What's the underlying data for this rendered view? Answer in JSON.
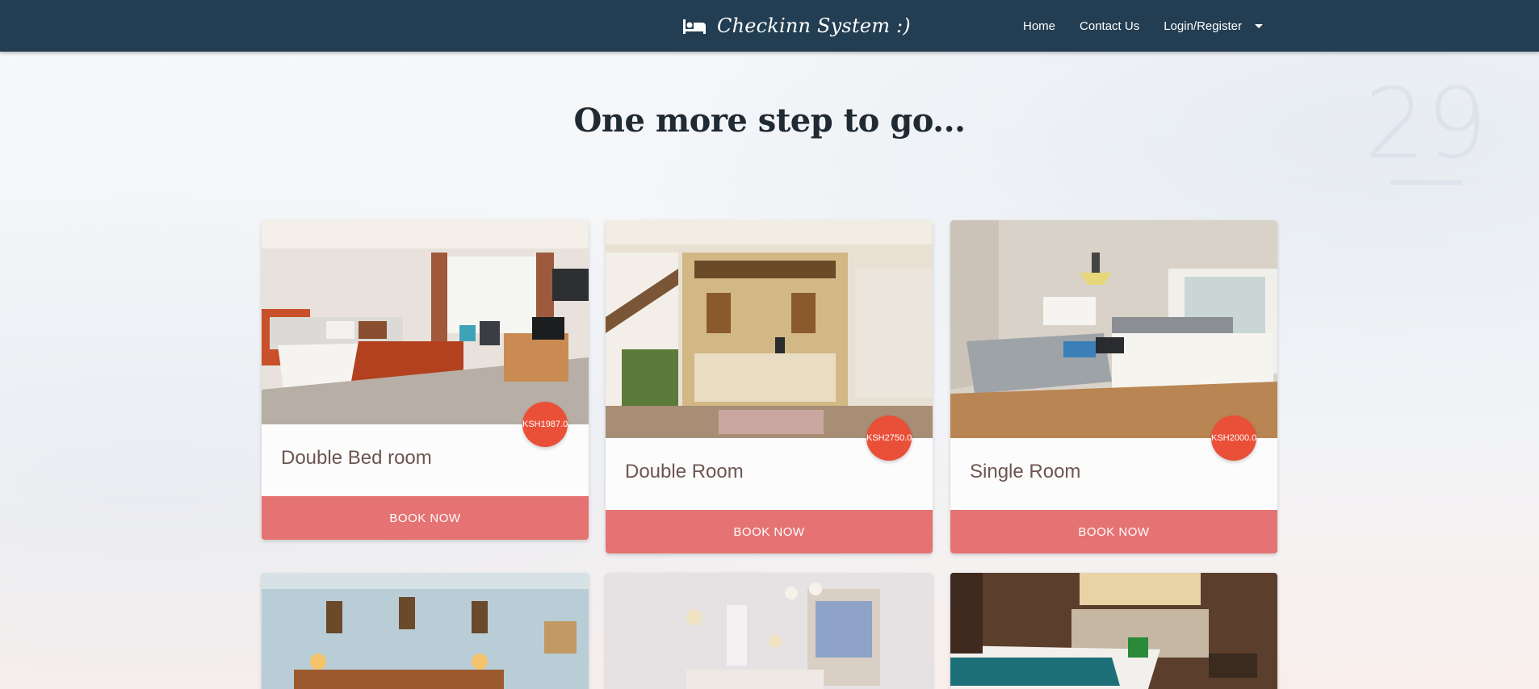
{
  "navbar": {
    "brand": "Checkinn System :)",
    "links": [
      {
        "label": "Home"
      },
      {
        "label": "Contact Us"
      },
      {
        "label": "Login/Register"
      }
    ]
  },
  "background": {
    "clock_number": "29"
  },
  "page_title": "One more step to go...",
  "rooms": [
    {
      "name": "Double Bed room",
      "price": "KSH1987.0",
      "button": "BOOK NOW",
      "icon": "bedroom-photo"
    },
    {
      "name": "Double Room",
      "price": "KSH2750.0",
      "button": "BOOK NOW",
      "icon": "reception-photo"
    },
    {
      "name": "Single Room",
      "price": "KSH2000.0",
      "button": "BOOK NOW",
      "icon": "single-room-photo"
    },
    {
      "icon": "room-photo-4"
    },
    {
      "icon": "room-photo-5"
    },
    {
      "icon": "room-photo-6"
    }
  ],
  "colors": {
    "navbar": "#233e52",
    "badge": "#ea4f38",
    "button": "#e57373",
    "title_text": "#6d5550"
  }
}
